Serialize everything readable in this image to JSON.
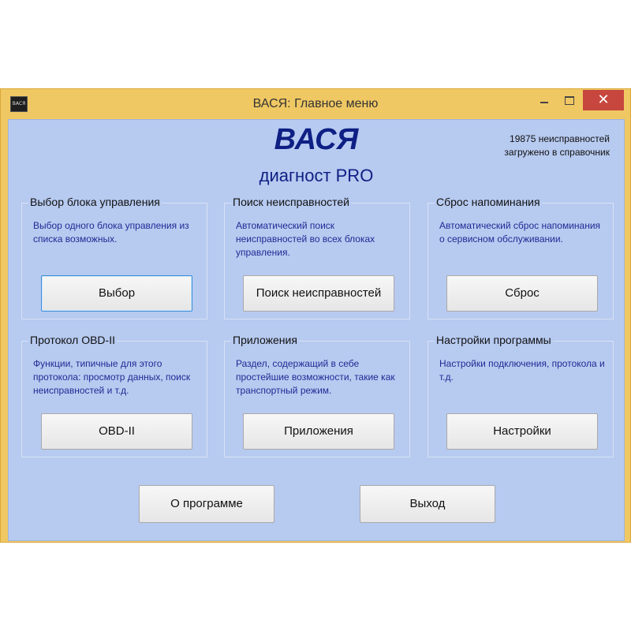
{
  "window": {
    "title": "ВАСЯ:  Главное меню",
    "icon_text": "ВАСЯ",
    "controls": {
      "minimize": "minimize-icon",
      "maximize": "maximize-icon",
      "close": "✕"
    }
  },
  "header": {
    "brand": "ВАСЯ",
    "subtitle": "диагност PRO",
    "info_line1": "19875 неисправностей",
    "info_line2": "загружено в справочник"
  },
  "groups": [
    {
      "title": "Выбор блока управления",
      "description": "Выбор одного блока управления из списка возможных.",
      "button": "Выбор"
    },
    {
      "title": "Поиск неисправностей",
      "description": "Автоматический поиск неисправностей во всех блоках управления.",
      "button": "Поиск неисправностей"
    },
    {
      "title": "Сброс напоминания",
      "description": "Автоматический сброс напоминания о сервисном обслуживании.",
      "button": "Сброс"
    },
    {
      "title": "Протокол OBD-II",
      "description": "Функции, типичные для этого протокола: просмотр данных, поиск неисправностей и т.д.",
      "button": "OBD-II"
    },
    {
      "title": "Приложения",
      "description": "Раздел, содержащий в себе простейшие возможности, такие как транспортный режим.",
      "button": "Приложения"
    },
    {
      "title": "Настройки программы",
      "description": "Настройки подключения, протокола и т.д.",
      "button": "Настройки"
    }
  ],
  "footer": {
    "about_label": "О программе",
    "exit_label": "Выход"
  },
  "colors": {
    "window_frame": "#f0c863",
    "client_bg": "#b7caf0",
    "brand": "#0e1f84",
    "desc_text": "#1e2b94",
    "close_button": "#c7463d"
  }
}
